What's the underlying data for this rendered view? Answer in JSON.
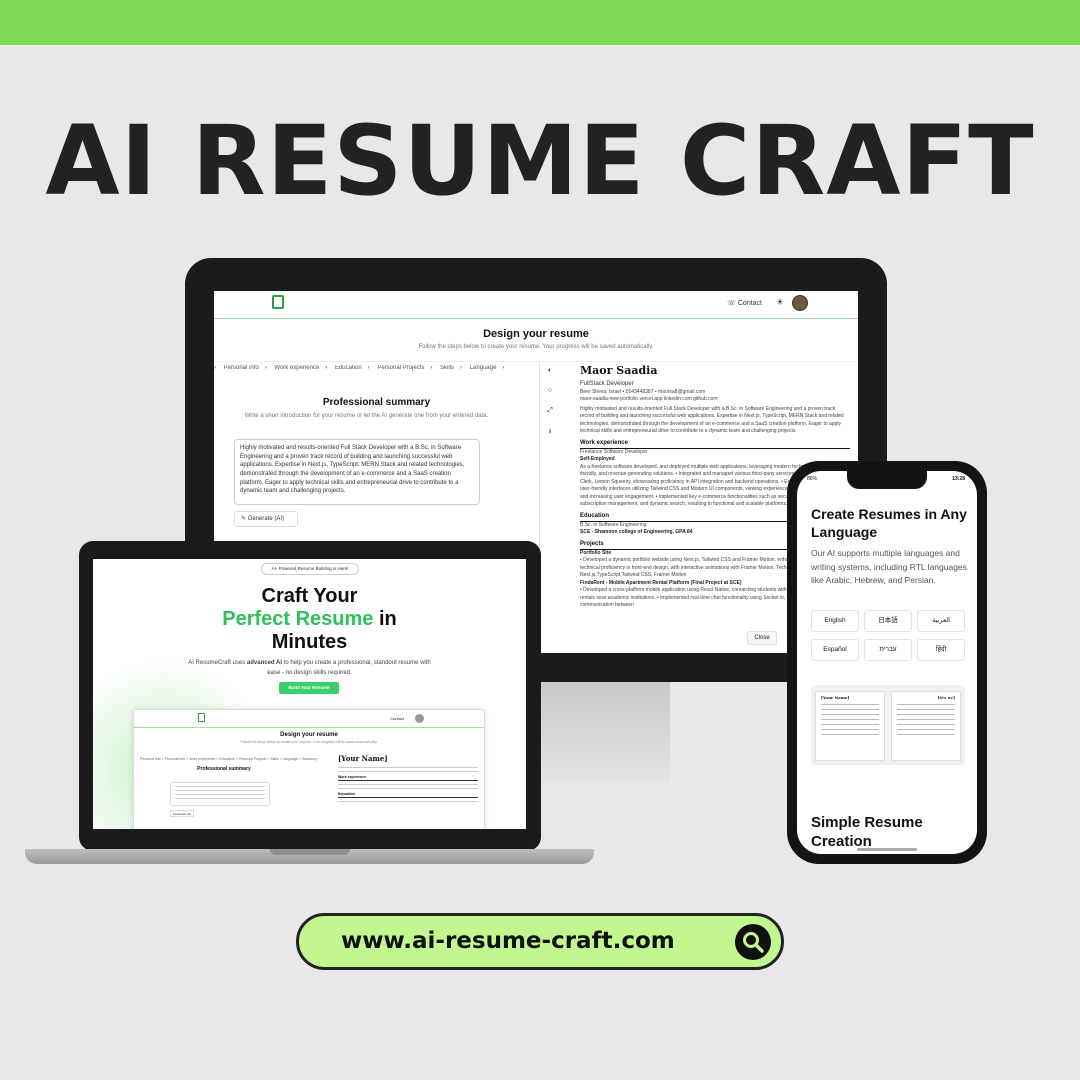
{
  "brand": {
    "title": "AI RESUME CRAFT",
    "accent": "#7ed957",
    "green": "#2fbf5b"
  },
  "monitor": {
    "nav": {
      "contact": "Contact",
      "theme_icon": "sun-icon"
    },
    "title": "Design your resume",
    "subtitle": "Follow the steps below to create your resume. Your progress will be saved automatically.",
    "steps": [
      "Personal info",
      "Work experience",
      "Education",
      "Personal Projects",
      "Skills",
      "Language"
    ],
    "section_title": "Professional summary",
    "section_sub": "Write a short introduction for your resume or let the AI generate one from your entered data.",
    "summary_text": "Highly motivated and results-oriented Full Stack Developer with a B.Sc. in Software Engineering and a proven track record of building and launching successful web applications. Expertise in Next.js, TypeScript, MERN Stack and related technologies, demonstrated through the development of an e-commerce and a SaaS creation platform. Eager to apply technical skills and entrepreneurial drive to contribute to a dynamic team and challenging projects.",
    "generate_label": "Generate (AI)",
    "close_label": "Close",
    "resume": {
      "name": "Maor Saadia",
      "role": "FullStack Developer",
      "contact": "Beer Sheva, Israel • 0543448387 • maorsa8@gmail.com",
      "links": "maor-saadia-new-portfolio.vercel.app   linkedin.com   github.com",
      "summary": "Highly motivated and results-oriented Full Stack Developer with a B.Sc. in Software Engineering and a proven track record of building and launching successful web applications. Expertise in Next.js, TypeScript, MERN Stack and related technologies, demonstrated through the development of an e-commerce and a SaaS creation platform. Eager to apply technical skills and entrepreneurial drive to contribute to a dynamic team and challenging projects.",
      "work_heading": "Work experience",
      "work_title": "Freelance Software Developer",
      "work_company": "Self-Employed",
      "work_bullets": "As a freelance software developed, and deployed multiple web applications, leveraging modern technologies, user-friendly, and revenue-generating solutions. • Integrated and managed various third-party services including Wix Studio, Clerk, Lemon Squeezy, showcasing proficiency in API integration and backend operations. • Engineered responsive and user-friendly interfaces utilizing Tailwind CSS and Modern UI components, viewing experiences across diverse devices and increasing user engagement. • Implemented key e-commerce functionalities such as secure authentication, tiered subscription management, and dynamic search, resulting in functional and scalable platforms.",
      "edu_heading": "Education",
      "edu_degree": "B.Sc. in Software Engineering",
      "edu_school": "SCE - Shamoon college of Engineering, GPA 84",
      "proj_heading": "Projects",
      "proj1_title": "Portfolio Site",
      "proj1_text": "• Developed a dynamic portfolio website using Next.js, Tailwind CSS and Framer Motion, enhancing, showcasing technical proficiency in front-end design, with interactive animations with Framer Motion. Technologies: Next.js,TypeScript,Tailwind CSS, Framer Motion",
      "proj2_title": "FindaRent - Mobile Apartment Rental Platform (Final Project at SCE)",
      "proj2_text": "• Developed a cross-platform mobile application using React Native, connecting students with landlords for apartment rentals near academic institutions. • Implemented real-time chat functionality using Socket.io, enabling instant communication between"
    }
  },
  "laptop": {
    "badge": "AI- Powered Resume Building is Here!",
    "headline_1": "Craft Your",
    "headline_green": "Perfect Resume",
    "headline_2": " in",
    "headline_3": "Minutes",
    "desc_pre": "AI ResumeCraft uses ",
    "desc_bold": "advanced AI",
    "desc_post": " to help you create a professional, standout resume with ease - no design skills required.",
    "cta": "Build Your Resume",
    "preview": {
      "contact": "Contact",
      "title": "Design your resume",
      "subtitle": "Follow the steps below to create your resume. Your progress will be saved automatically.",
      "steps": "Personal Info  >  Personal Info  >  Work experience  >  Education  >  Personal Projects  >  Skills  >  Language  >  Summary",
      "section_title": "Professional summary",
      "generate": "Generate (AI)",
      "name": "[Your Name]",
      "work_heading": "Work experience",
      "edu_heading": "Education"
    }
  },
  "phone": {
    "status_left": "86%",
    "status_right": "13:28",
    "heading": "Create Resumes in Any Language",
    "desc": "Our AI supports multiple languages and writing systems, including RTL languages like Arabic, Hebrew, and Persian.",
    "languages": [
      "English",
      "日本語",
      "العربية",
      "Español",
      "עברית",
      "हिंदी"
    ],
    "tpl1_name": "[Your Name]",
    "tpl2_name": "[שם מלא]",
    "section2_heading": "Simple Resume Creation"
  },
  "footer": {
    "url": "www.ai-resume-craft.com",
    "icon": "search-icon"
  }
}
